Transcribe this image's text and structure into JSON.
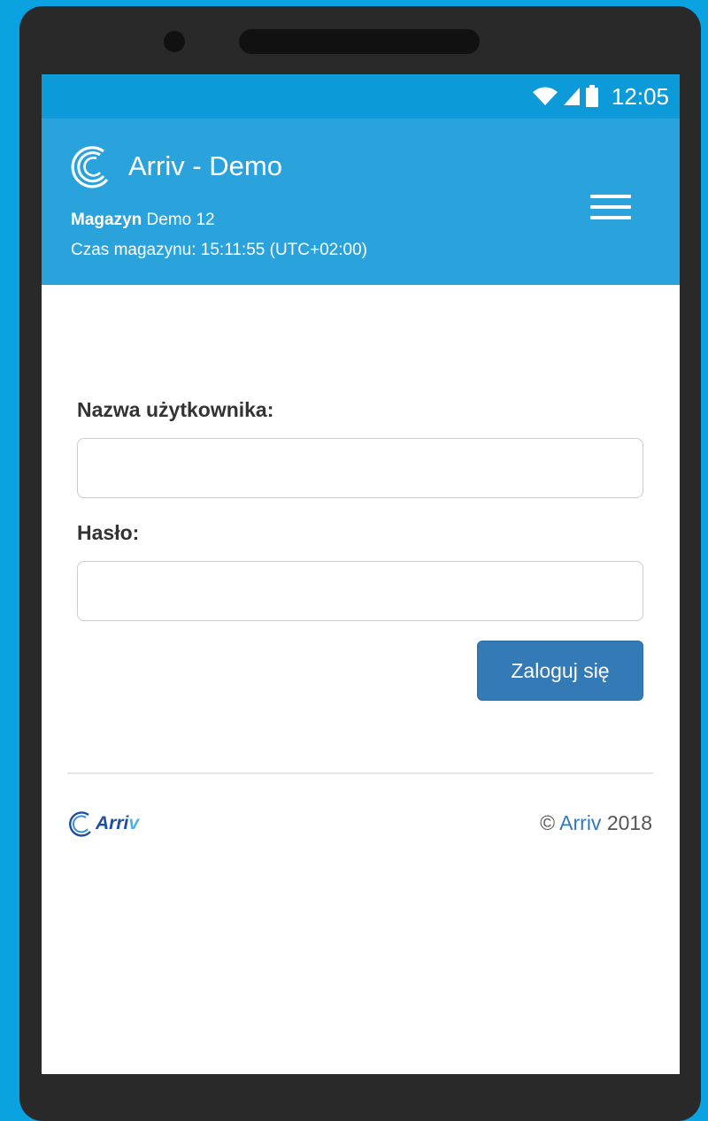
{
  "status_bar": {
    "time": "12:05",
    "icons": [
      "wifi-icon",
      "signal-icon",
      "battery-icon"
    ]
  },
  "header": {
    "app_title": "Arriv - Demo",
    "warehouse_label": "Magazyn",
    "warehouse_name": "Demo 12",
    "warehouse_time": "Czas magazynu: 15:11:55 (UTC+02:00)",
    "menu_icon": "hamburger-menu-icon"
  },
  "login_form": {
    "username_label": "Nazwa użytkownika:",
    "username_value": "",
    "password_label": "Hasło:",
    "password_value": "",
    "submit_label": "Zaloguj się"
  },
  "footer": {
    "logo_text_main": "Arri",
    "logo_text_tail": "v",
    "copyright_symbol": "©",
    "copyright_link": "Arriv",
    "copyright_year": "2018"
  },
  "colors": {
    "background": "#0aa2e0",
    "header": "#2aa3dd",
    "status_bar": "#0c9bd8",
    "primary_button": "#337ab7",
    "link": "#337ab7"
  }
}
